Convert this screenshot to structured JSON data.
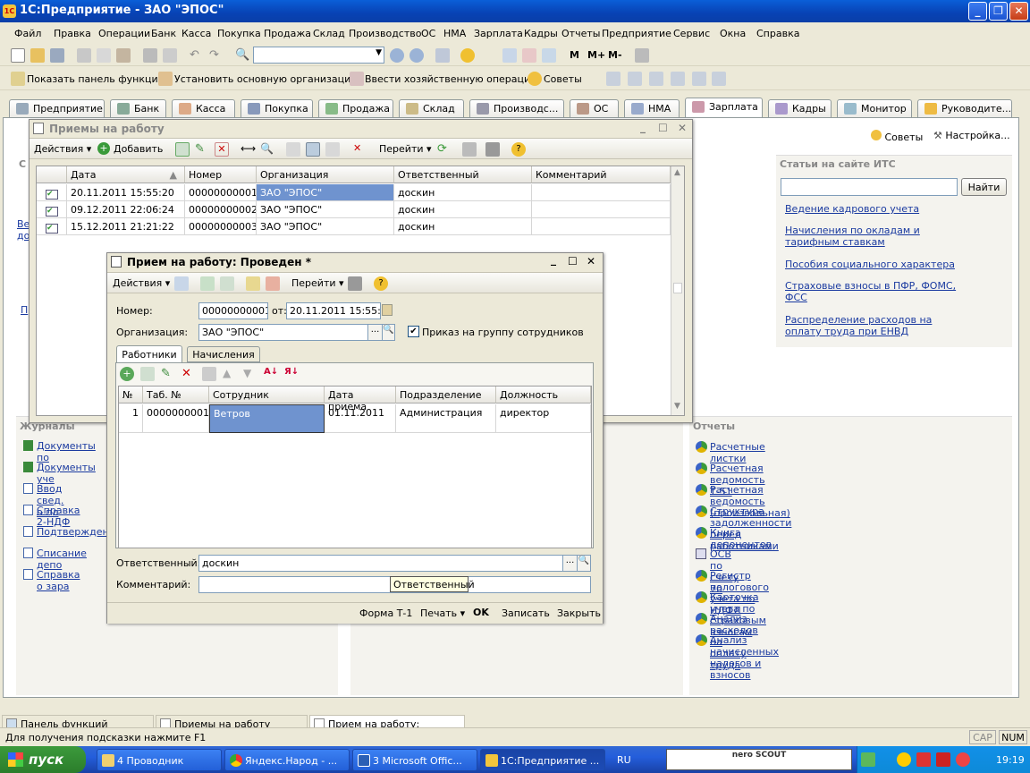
{
  "app": {
    "title": "1С:Предприятие - ЗАО \"ЭПОС\""
  },
  "menu": [
    "Файл",
    "Правка",
    "Операции",
    "Банк",
    "Касса",
    "Покупка",
    "Продажа",
    "Склад",
    "Производство",
    "ОС",
    "НМА",
    "Зарплата",
    "Кадры",
    "Отчеты",
    "Предприятие",
    "Сервис",
    "Окна",
    "Справка"
  ],
  "toolbar2": {
    "show_panel": "Показать панель функций",
    "set_org": "Установить основную организацию",
    "enter_op": "Ввести хозяйственную операцию",
    "tips": "Советы",
    "m": "M",
    "mplus": "M+",
    "mminus": "M-"
  },
  "tabs": [
    "Предприятие",
    "Банк",
    "Касса",
    "Покупка",
    "Продажа",
    "Склад",
    "Производс...",
    "ОС",
    "НМА",
    "Зарплата",
    "Кадры",
    "Монитор",
    "Руководите..."
  ],
  "panel": {
    "tips": "Советы",
    "settings": "Настройка...",
    "its_header": "Статьи на сайте ИТС",
    "find": "Найти",
    "its_links": [
      "Ведение кадрового учета",
      "Начисления по окладам и тарифным ставкам",
      "Пособия социального характера",
      "Страховые взносы в ПФР, ФОМС, ФСС",
      "Распределение расходов на оплату труда при ЕНВД"
    ],
    "journals_header": "Журналы",
    "journals": [
      "Документы по",
      "Документы уче",
      "Ввод свед. о пл",
      "Справка 2-НДФ",
      "Подтверждение",
      "Списание депо",
      "Справка о зара"
    ],
    "left_partial": [
      "С",
      "Ве",
      "до",
      "П"
    ],
    "reports_header": "Отчеты",
    "reports": [
      "Расчетные листки",
      "Расчетная ведомость Т-51",
      "Расчетная ведомость (произвольная)",
      "Структура задолженности перед работниками",
      "Книга депонентов",
      "ОСВ по счету 70",
      "Регистр налогового учета по НДФЛ",
      "Карточка учета по страховым взносам",
      "Анализ расходов на оплату труда",
      "Анализ начисленных налогов и взносов"
    ]
  },
  "list_window": {
    "title": "Приемы на работу",
    "actions": "Действия",
    "add": "Добавить",
    "goto": "Перейти",
    "columns": [
      "Дата",
      "Номер",
      "Организация",
      "Ответственный",
      "Комментарий"
    ],
    "rows": [
      {
        "date": "20.11.2011 15:55:20",
        "num": "00000000001",
        "org": "ЗАО \"ЭПОС\"",
        "resp": "доскин",
        "comment": ""
      },
      {
        "date": "09.12.2011 22:06:24",
        "num": "00000000002",
        "org": "ЗАО \"ЭПОС\"",
        "resp": "доскин",
        "comment": ""
      },
      {
        "date": "15.12.2011 21:21:22",
        "num": "00000000003",
        "org": "ЗАО \"ЭПОС\"",
        "resp": "доскин",
        "comment": ""
      }
    ]
  },
  "doc_window": {
    "title": "Прием на работу: Проведен *",
    "actions": "Действия",
    "goto": "Перейти",
    "num_label": "Номер:",
    "num_value": "00000000001",
    "from_label": "от:",
    "date_value": "20.11.2011 15:55:20",
    "org_label": "Организация:",
    "org_value": "ЗАО \"ЭПОС\"",
    "group_check": "Приказ на группу сотрудников",
    "tabs": [
      "Работники",
      "Начисления"
    ],
    "columns": [
      "№",
      "Таб. №",
      "Сотрудник",
      "Дата приема",
      "Подразделение",
      "Должность"
    ],
    "rows": [
      {
        "n": "1",
        "tab": "0000000001",
        "emp": "Ветров",
        "date": "01.11.2011",
        "dept": "Администрация",
        "pos": "директор"
      }
    ],
    "resp_label": "Ответственный:",
    "resp_value": "доскин",
    "comment_label": "Комментарий:",
    "tooltip": "Ответственный",
    "bottom": {
      "form": "Форма Т-1",
      "print": "Печать",
      "ok": "OK",
      "save": "Записать",
      "close": "Закрыть"
    }
  },
  "windows_bar": [
    "Панель функций",
    "Приемы на работу",
    "Прием на работу: Проведен *"
  ],
  "status": {
    "hint": "Для получения подсказки нажмите F1",
    "cap": "CAP",
    "num": "NUM"
  },
  "taskbar": {
    "start": "пуск",
    "items": [
      "4 Проводник",
      "Яндекс.Народ - ...",
      "3 Microsoft Offic...",
      "1С:Предприятие ..."
    ],
    "lang": "RU",
    "nero": "nero SCOUT",
    "time": "19:19"
  },
  "colors": {
    "xp_blue": "#0842b4",
    "selection": "#6f93cf",
    "link": "#1a3aa0"
  }
}
